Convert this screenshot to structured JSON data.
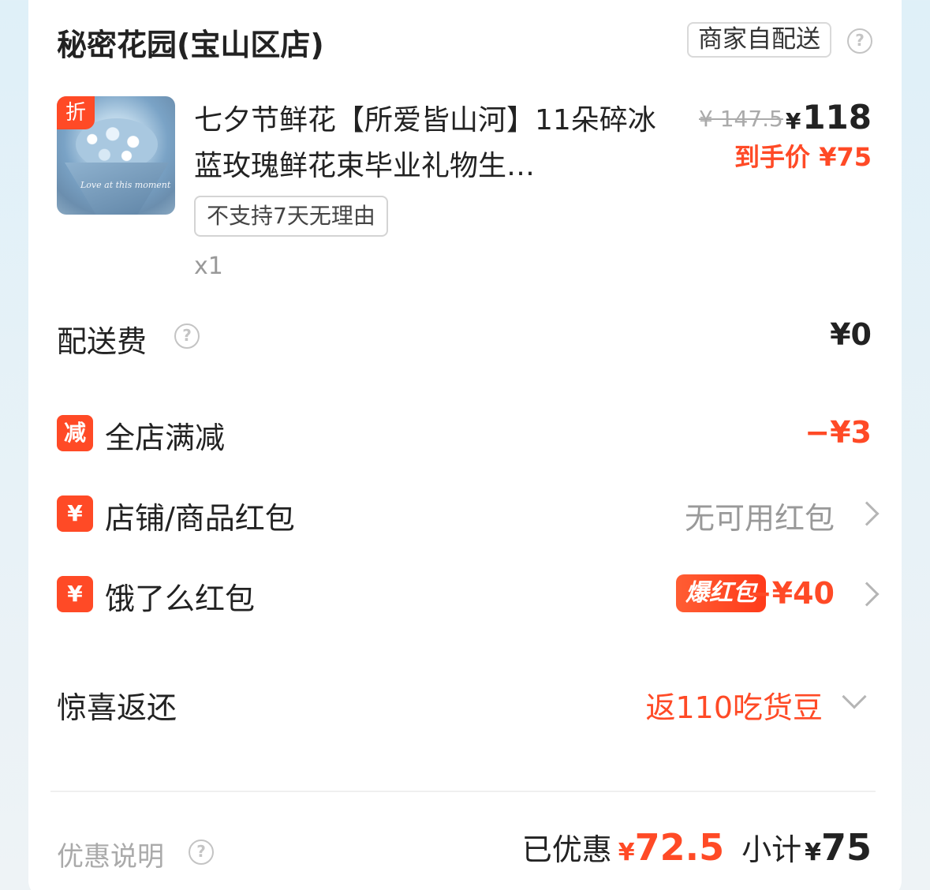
{
  "shop": {
    "name": "秘密花园(宝山区店)",
    "delivery_tag": "商家自配送",
    "help_icon": "question-circle-icon"
  },
  "product": {
    "discount_badge": "折",
    "title": "七夕节鲜花【所爱皆山河】11朵碎冰蓝玫瑰鲜花束毕业礼物生…",
    "image_caption": "Love at this moment",
    "policy_tag": "不支持7天无理由",
    "quantity": "x1",
    "original_price": "¥ 147.5",
    "price_symbol": "¥",
    "price": "118",
    "final_price_label": "到手价",
    "final_price": "¥75"
  },
  "fees": {
    "delivery": {
      "label": "配送费",
      "value": "¥0",
      "icon": "question-circle-icon"
    }
  },
  "promotions": [
    {
      "icon_text": "减",
      "label": "全店满减",
      "value": "−¥3"
    },
    {
      "icon_text": "¥",
      "label": "店铺/商品红包",
      "value": "无可用红包"
    },
    {
      "icon_text": "¥",
      "label": "饿了么红包",
      "badge": "爆红包",
      "value": "−¥40"
    }
  ],
  "cashback": {
    "label": "惊喜返还",
    "value": "返110吃货豆"
  },
  "footer": {
    "note": "优惠说明",
    "saved_label": "已优惠",
    "saved_symbol": "¥",
    "saved_value": "72.5",
    "subtotal_label": "小计",
    "subtotal_symbol": "¥",
    "subtotal_value": "75"
  },
  "colors": {
    "accent": "#ff4a26",
    "text": "#222222",
    "muted": "#999999"
  }
}
